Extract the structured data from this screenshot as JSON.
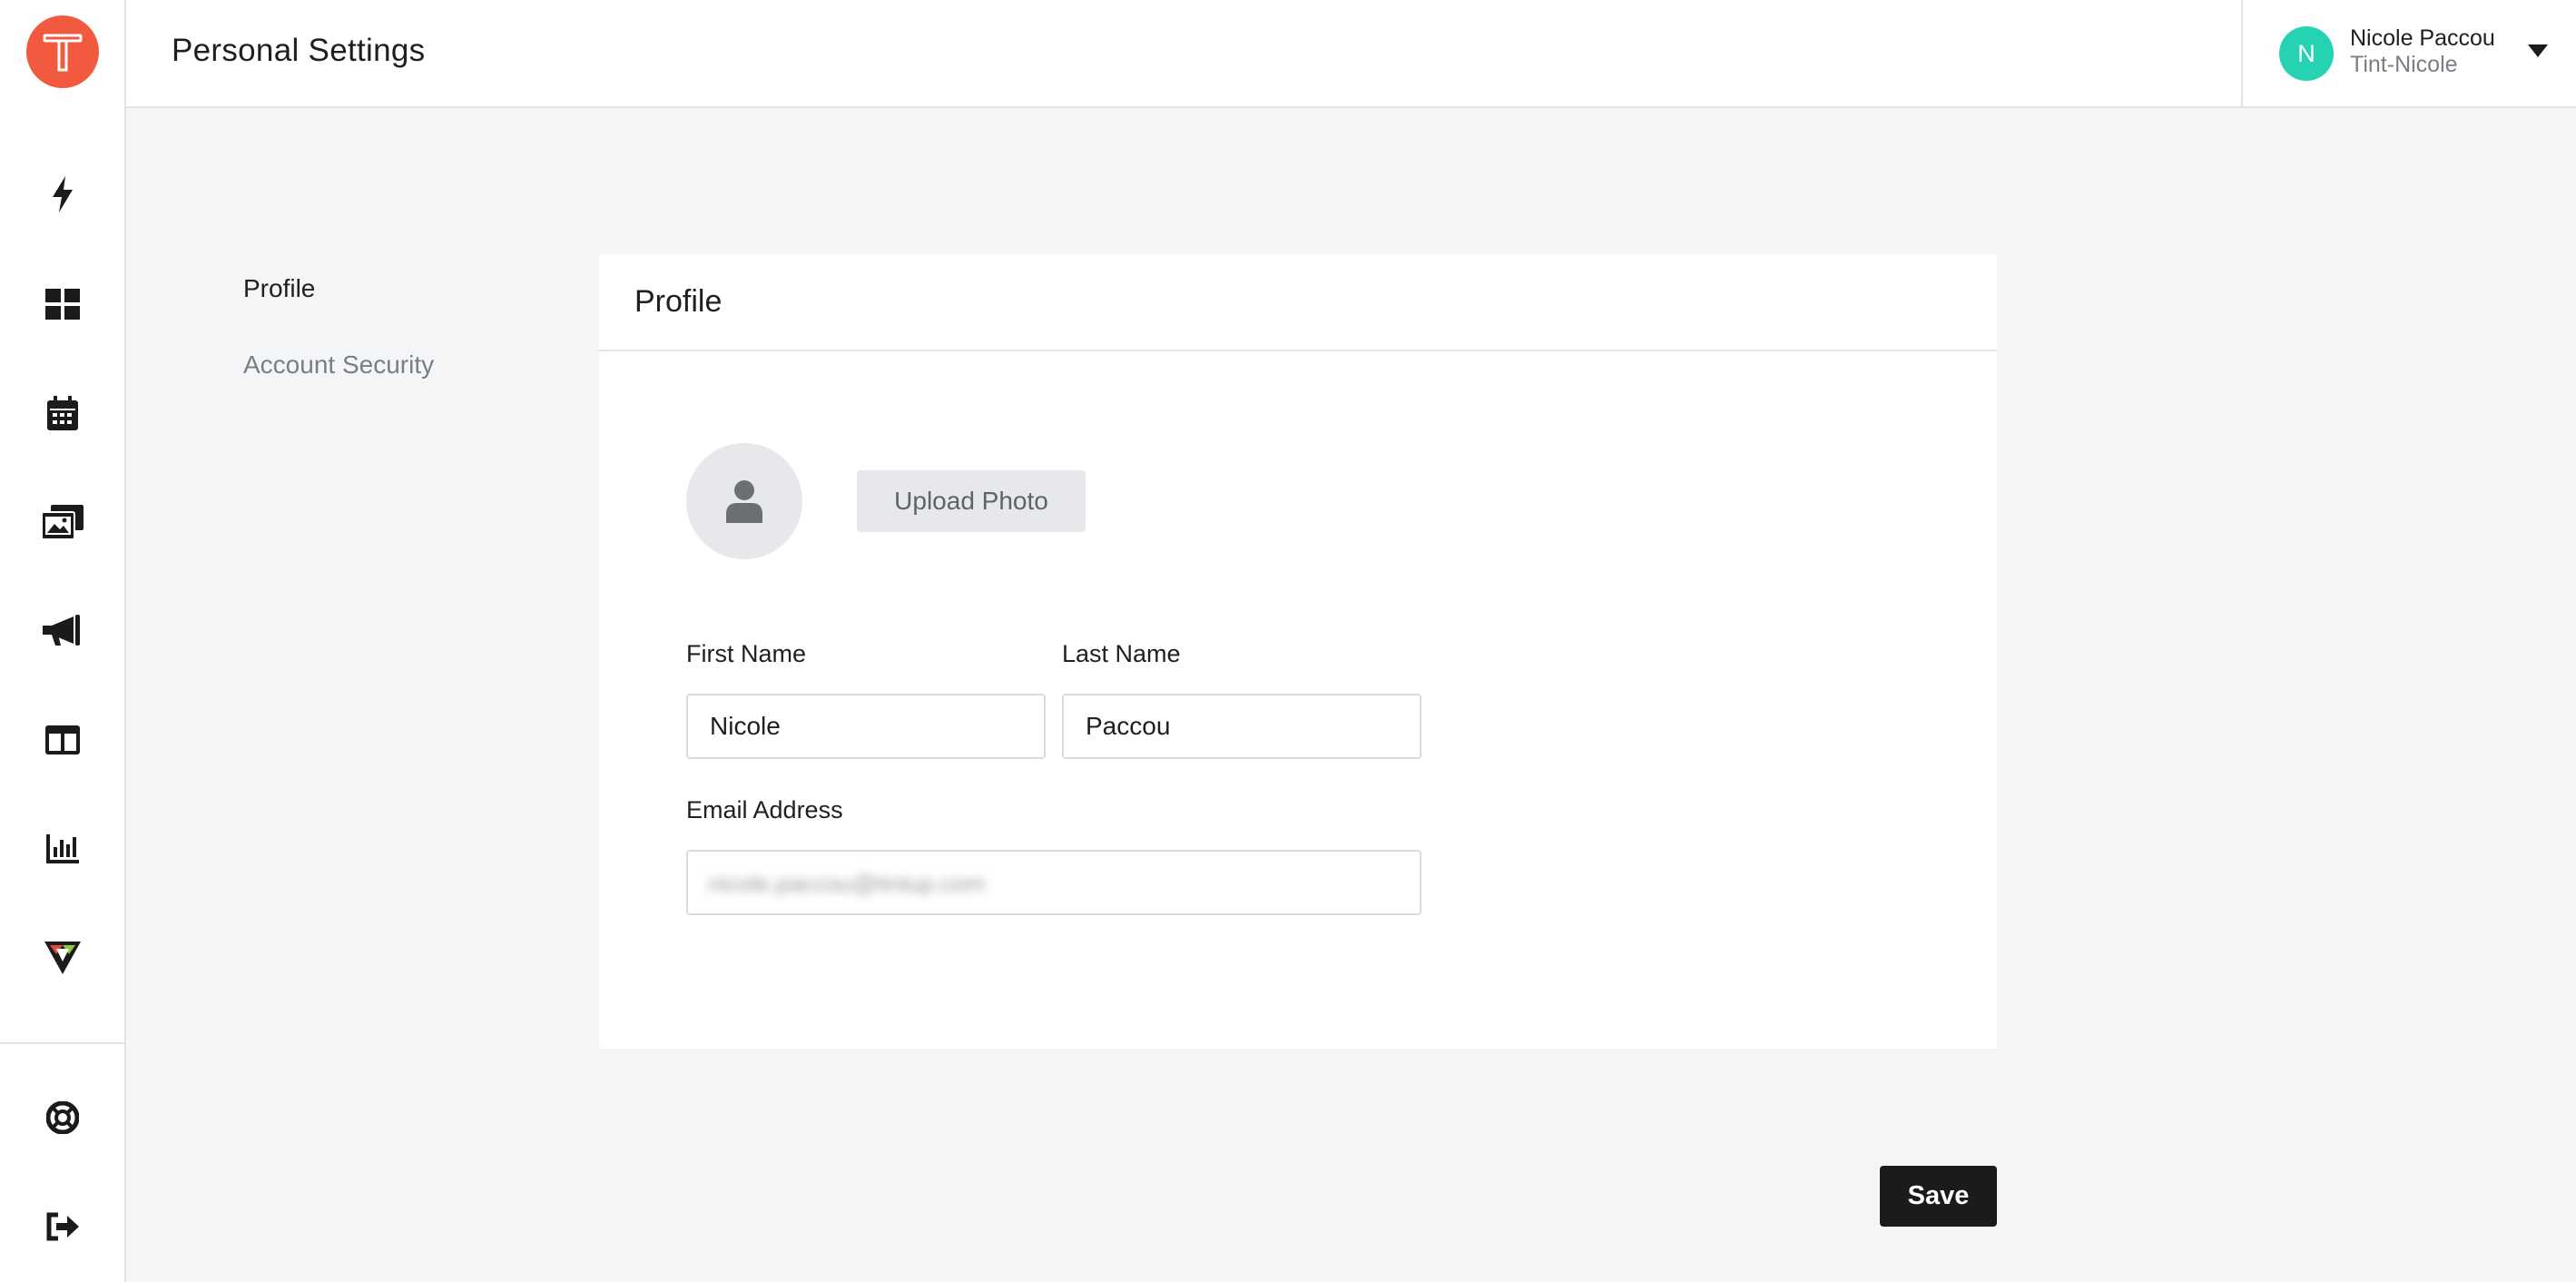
{
  "header": {
    "title": "Personal Settings"
  },
  "user": {
    "initial": "N",
    "name": "Nicole Paccou",
    "org": "Tint-Nicole"
  },
  "sidebar": {
    "icons": [
      "bolt-icon",
      "dashboard-icon",
      "calendar-icon",
      "gallery-icon",
      "megaphone-icon",
      "layout-icon",
      "analytics-icon",
      "vision-icon",
      "help-icon",
      "logout-icon"
    ]
  },
  "settings_nav": {
    "profile": "Profile",
    "account_security": "Account Security"
  },
  "profile_card": {
    "title": "Profile",
    "upload_photo": "Upload Photo",
    "first_name_label": "First Name",
    "first_name_value": "Nicole",
    "last_name_label": "Last Name",
    "last_name_value": "Paccou",
    "email_label": "Email Address",
    "email_value": "nicole.paccou@tintup.com"
  },
  "actions": {
    "save": "Save"
  },
  "colors": {
    "brand": "#f15a3f",
    "avatar": "#25d3b3",
    "save_button": "#1b1b1b",
    "background": "#f4f5f7"
  }
}
